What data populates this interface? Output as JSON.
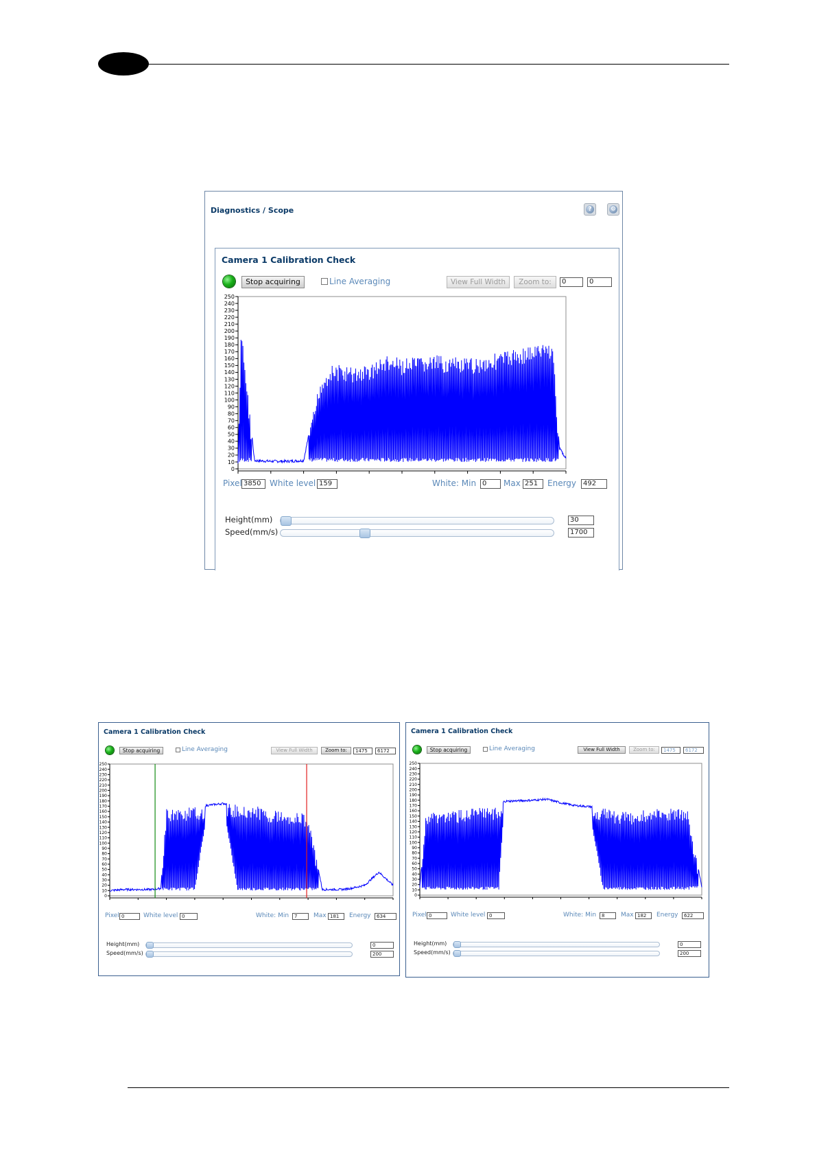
{
  "main": {
    "breadcrumb": "Diagnostics / Scope",
    "title": "Camera 1 Calibration Check",
    "stop_label": "Stop acquiring",
    "line_avg_label": "Line Averaging",
    "view_full_label": "View Full Width",
    "zoom_label": "Zoom to:",
    "zoom_from": "0",
    "zoom_to": "0",
    "pixel_label": "Pixel",
    "pixel_value": "3850",
    "white_level_label": "White level",
    "white_level_value": "159",
    "white_min_label": "White: Min",
    "white_min_value": "0",
    "max_label": "Max",
    "max_value": "251",
    "energy_label": "Energy",
    "energy_value": "492",
    "height_label": "Height(mm)",
    "height_value": "30",
    "speed_label": "Speed(mm/s)",
    "speed_value": "1700",
    "height_slider": 0,
    "speed_slider": 0.3
  },
  "left": {
    "title": "Camera 1 Calibration Check",
    "stop_label": "Stop acquiring",
    "line_avg_label": "Line Averaging",
    "view_full_label": "View Full Width",
    "zoom_label": "Zoom to:",
    "zoom_from": "1475",
    "zoom_to": "6172",
    "pixel_label": "Pixel",
    "pixel_value": "0",
    "white_level_label": "White level",
    "white_level_value": "0",
    "white_min_label": "White: Min",
    "white_min_value": "7",
    "max_label": "Max",
    "max_value": "181",
    "energy_label": "Energy",
    "energy_value": "634",
    "height_label": "Height(mm)",
    "height_value": "0",
    "speed_label": "Speed(mm/s)",
    "speed_value": "200",
    "height_slider": 0,
    "speed_slider": 0
  },
  "right": {
    "title": "Camera 1 Calibration Check",
    "stop_label": "Stop acquiring",
    "line_avg_label": "Line Averaging",
    "view_full_label": "View Full Width",
    "zoom_label": "Zoom to:",
    "zoom_from": "1475",
    "zoom_to": "6172",
    "pixel_label": "Pixel",
    "pixel_value": "0",
    "white_level_label": "White level",
    "white_level_value": "0",
    "white_min_label": "White: Min",
    "white_min_value": "8",
    "max_label": "Max",
    "max_value": "182",
    "energy_label": "Energy",
    "energy_value": "622",
    "height_label": "Height(mm)",
    "height_value": "0",
    "speed_label": "Speed(mm/s)",
    "speed_value": "200",
    "height_slider": 0,
    "speed_slider": 0
  },
  "icons": {
    "help": "help-icon",
    "settings": "settings-icon",
    "status": "status-led-icon"
  },
  "colors": {
    "signal": "#0000ff",
    "zoom_start_marker": "#138a13",
    "zoom_end_marker": "#e02020",
    "title": "#0b3a67",
    "label": "#5a88b8"
  },
  "chart_data": [
    {
      "type": "line",
      "title": "",
      "xlabel": "",
      "ylabel": "",
      "ylim": [
        0,
        250
      ],
      "yticks": [
        0,
        10,
        20,
        30,
        40,
        50,
        60,
        70,
        80,
        90,
        100,
        110,
        120,
        130,
        140,
        150,
        160,
        170,
        180,
        190,
        200,
        210,
        220,
        230,
        240,
        250
      ],
      "grid": false,
      "series": [
        {
          "x": [
            0,
            1,
            5,
            10,
            15,
            20,
            25,
            28,
            30,
            35,
            40,
            45,
            50,
            60,
            70,
            80,
            90,
            96,
            98,
            100
          ],
          "y": [
            8,
            210,
            12,
            11,
            11,
            12,
            130,
            150,
            152,
            148,
            152,
            165,
            160,
            165,
            160,
            170,
            180,
            185,
            30,
            15
          ],
          "envelope_low": [
            8,
            10,
            10,
            10,
            10,
            10,
            10,
            10,
            10,
            10,
            10,
            10,
            10,
            10,
            10,
            10,
            10,
            10,
            10,
            8
          ],
          "note_x_normalized": true
        }
      ]
    },
    {
      "type": "line",
      "title": "",
      "ylim": [
        0,
        250
      ],
      "yticks": [
        0,
        10,
        20,
        30,
        40,
        50,
        60,
        70,
        80,
        90,
        100,
        110,
        120,
        130,
        140,
        150,
        160,
        170,
        180,
        190,
        200,
        210,
        220,
        230,
        240,
        250
      ],
      "grid": false,
      "markers": [
        "zoom-start",
        "zoom-end"
      ],
      "series": [
        {
          "x": [
            0,
            5,
            15,
            18,
            20,
            30,
            35,
            40,
            45,
            52,
            55,
            60,
            65,
            70,
            75,
            82,
            85,
            90,
            95,
            100
          ],
          "y": [
            10,
            12,
            12,
            14,
            165,
            168,
            172,
            175,
            173,
            170,
            165,
            162,
            160,
            155,
            12,
            12,
            14,
            20,
            45,
            20
          ],
          "envelope_low": [
            10,
            10,
            10,
            10,
            10,
            10,
            175,
            175,
            10,
            10,
            10,
            10,
            10,
            10,
            10,
            10,
            10,
            10,
            10,
            10
          ]
        }
      ]
    },
    {
      "type": "line",
      "title": "",
      "ylim": [
        0,
        250
      ],
      "yticks": [
        0,
        10,
        20,
        30,
        40,
        50,
        60,
        70,
        80,
        90,
        100,
        110,
        120,
        130,
        140,
        150,
        160,
        170,
        180,
        190,
        200,
        210,
        220,
        230,
        240,
        250
      ],
      "grid": false,
      "series": [
        {
          "x": [
            0,
            2,
            5,
            10,
            20,
            28,
            30,
            40,
            45,
            48,
            50,
            55,
            60,
            65,
            70,
            75,
            80,
            90,
            95,
            100
          ],
          "y": [
            15,
            150,
            160,
            160,
            165,
            168,
            178,
            180,
            182,
            178,
            175,
            170,
            168,
            165,
            160,
            158,
            162,
            165,
            160,
            15
          ],
          "envelope_low": [
            15,
            10,
            10,
            10,
            10,
            10,
            175,
            178,
            178,
            178,
            172,
            168,
            165,
            10,
            10,
            10,
            10,
            10,
            10,
            15
          ]
        }
      ]
    }
  ]
}
